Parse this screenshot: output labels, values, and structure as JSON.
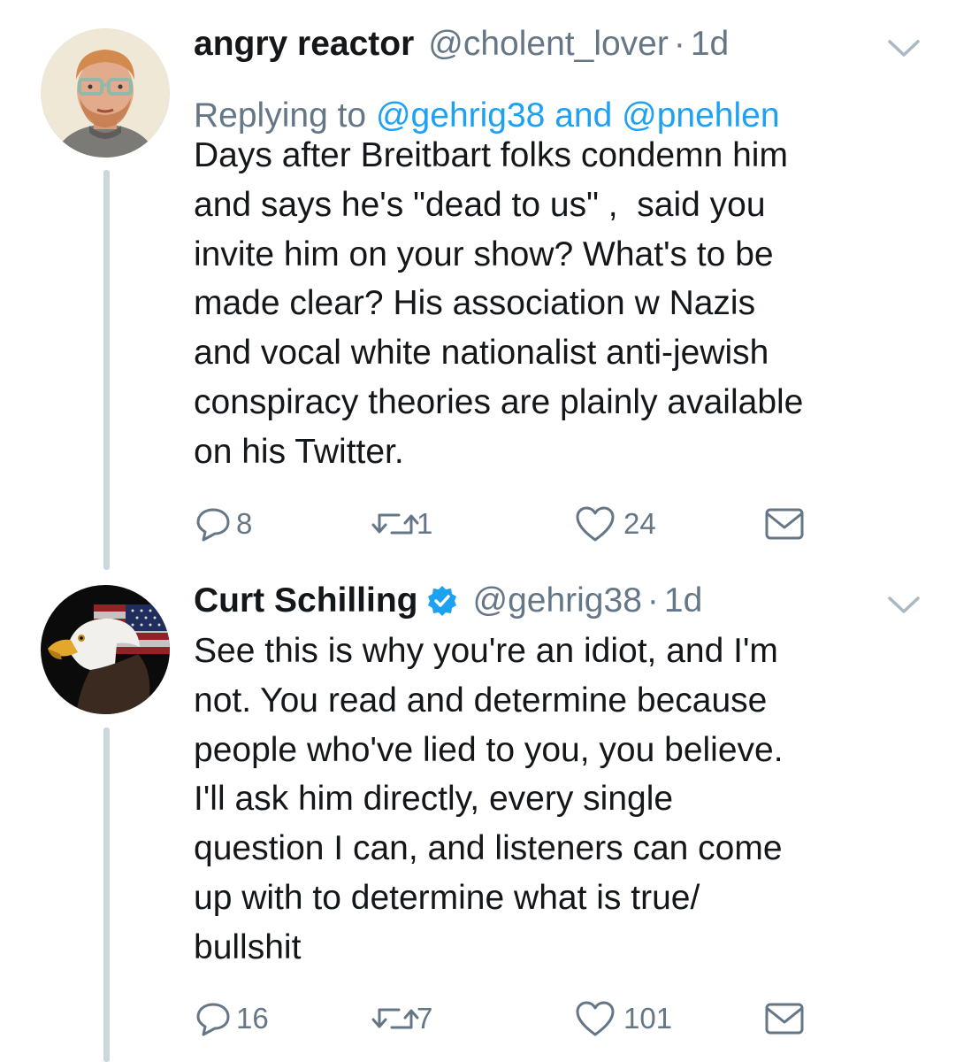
{
  "tweets": [
    {
      "display_name": "angry reactor",
      "handle": "@cholent_lover",
      "separator": "·",
      "time": "1d",
      "replying_prefix": "Replying to",
      "replying_to_1": "@gehrig38",
      "replying_and": "and",
      "replying_to_2": "@pnehlen",
      "lines": [
        "Days after Breitbart folks condemn him",
        "and says he's \"dead to us\" ,  said you",
        "invite him on your show? What's to be",
        "made clear? His association w Nazis",
        "and vocal white nationalist anti-jewish",
        "conspiracy theories are plainly available",
        "on his Twitter."
      ],
      "replies": "8",
      "retweets": "1",
      "likes": "24",
      "avatar_icon": "cartoon-portrait-avatar",
      "verified": false
    },
    {
      "display_name": "Curt Schilling",
      "handle": "@gehrig38",
      "separator": "·",
      "time": "1d",
      "lines": [
        "See this is why you're an idiot, and I'm",
        "not. You read and determine because",
        "people who've lied to you, you believe.",
        "I'll ask him directly, every single",
        "question I can, and listeners can come",
        "up with to determine what is true/",
        "bullshit"
      ],
      "replies": "16",
      "retweets": "7",
      "likes": "101",
      "avatar_icon": "eagle-flag-avatar",
      "verified": true
    }
  ],
  "colors": {
    "text": "#14171a",
    "secondary": "#657786",
    "link": "#1da1f2",
    "thread_line": "#ccd6dd"
  }
}
